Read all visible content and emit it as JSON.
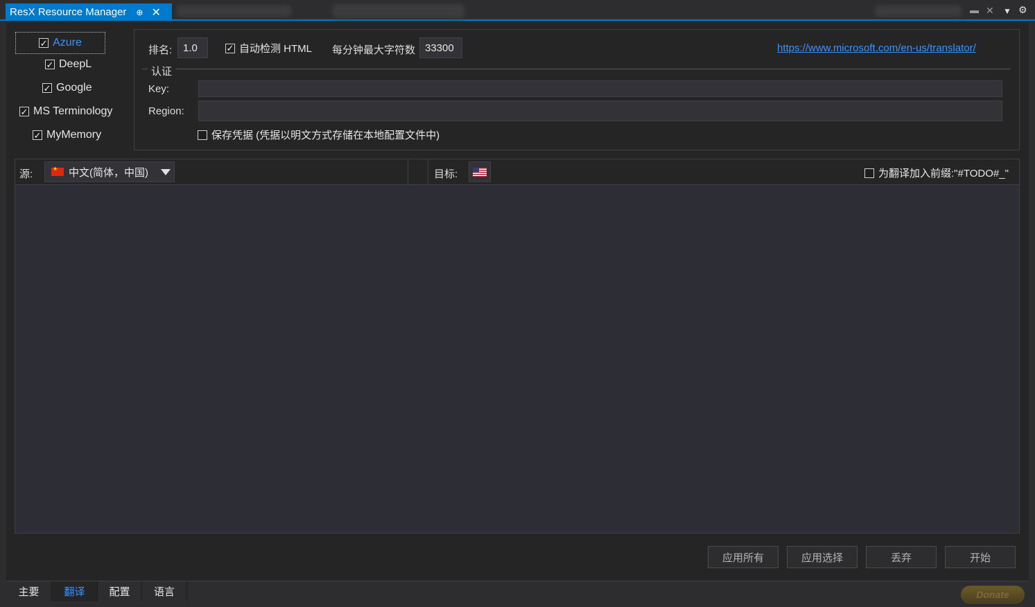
{
  "window": {
    "tab_title": "ResX Resource Manager",
    "pin_glyph": "⊕",
    "close_glyph": "✕"
  },
  "providers": [
    {
      "label": "Azure",
      "checked": true,
      "selected": true
    },
    {
      "label": "DeepL",
      "checked": true
    },
    {
      "label": "Google",
      "checked": true
    },
    {
      "label": "MS Terminology",
      "checked": true
    },
    {
      "label": "MyMemory",
      "checked": true
    }
  ],
  "config": {
    "rank_label": "排名:",
    "rank_value": "1.0",
    "auto_html_label": "自动检测 HTML",
    "max_chars_label": "每分钟最大字符数",
    "max_chars_value": "33300",
    "link": "https://www.microsoft.com/en-us/translator/",
    "auth_group": "认证",
    "key_label": "Key:",
    "key_value": "",
    "region_label": "Region:",
    "region_value": "",
    "save_credentials_label": "保存凭据 (凭据以明文方式存储在本地配置文件中)"
  },
  "language": {
    "source_label": "源:",
    "source_value": "中文(简体，中国)",
    "target_label": "目标:",
    "prefix_label": "为翻译加入前缀:\"#TODO#_\""
  },
  "buttons": {
    "apply_all": "应用所有",
    "apply_selected": "应用选择",
    "discard": "丢弃",
    "start": "开始"
  },
  "bottom_tabs": [
    "主要",
    "翻译",
    "配置",
    "语言"
  ],
  "donate_label": "Donate",
  "colors": {
    "accent": "#007acc",
    "link": "#3794ff",
    "background": "#2d2d30"
  }
}
